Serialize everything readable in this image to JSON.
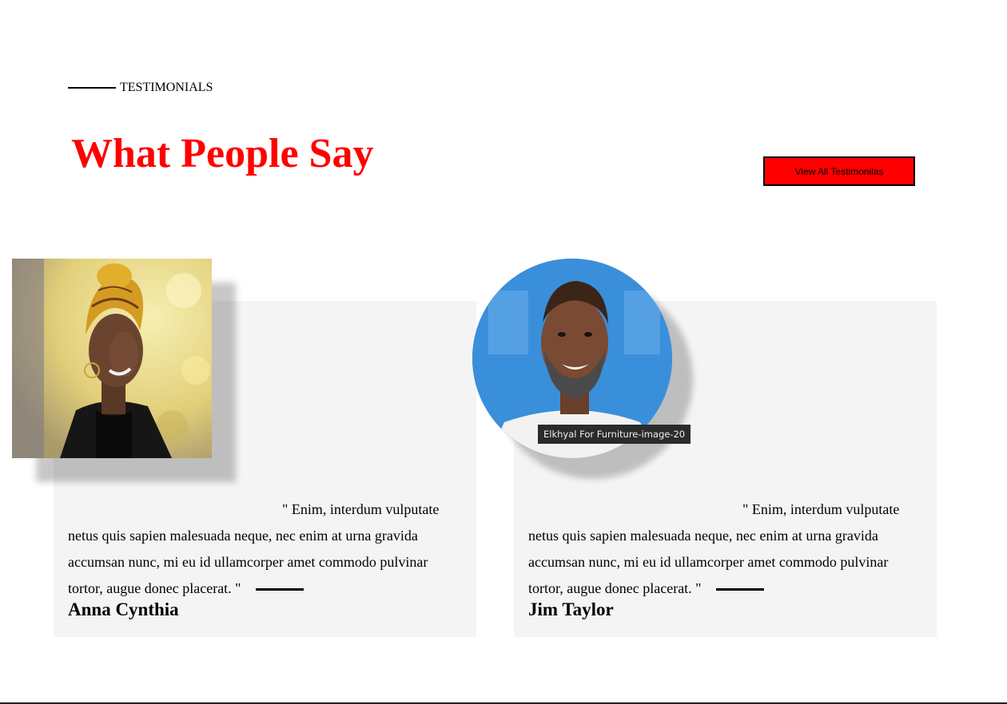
{
  "section": {
    "eyebrow": "TESTIMONIALS",
    "title": "What People Say",
    "title_color": "#ff0000",
    "view_all_label": "View All Testimonilas",
    "button_color": "#ff0000"
  },
  "testimonials": [
    {
      "quote": "\" Enim, interdum vulputate netus quis sapien malesuada neque, nec enim at urna gravida accumsan nunc, mi eu id ullamcorper amet commodo pulvinar tortor, augue donec placerat. \"",
      "author": "Anna Cynthia",
      "photo_icon": "woman-portrait-photo"
    },
    {
      "quote": "\" Enim, interdum vulputate netus quis sapien malesuada neque, nec enim at urna gravida accumsan nunc, mi eu id ullamcorper amet commodo pulvinar tortor, augue donec placerat. \"",
      "author": "Jim Taylor",
      "photo_icon": "man-portrait-photo"
    }
  ],
  "tooltip": {
    "text": "Elkhyal For Furniture-image-20"
  }
}
